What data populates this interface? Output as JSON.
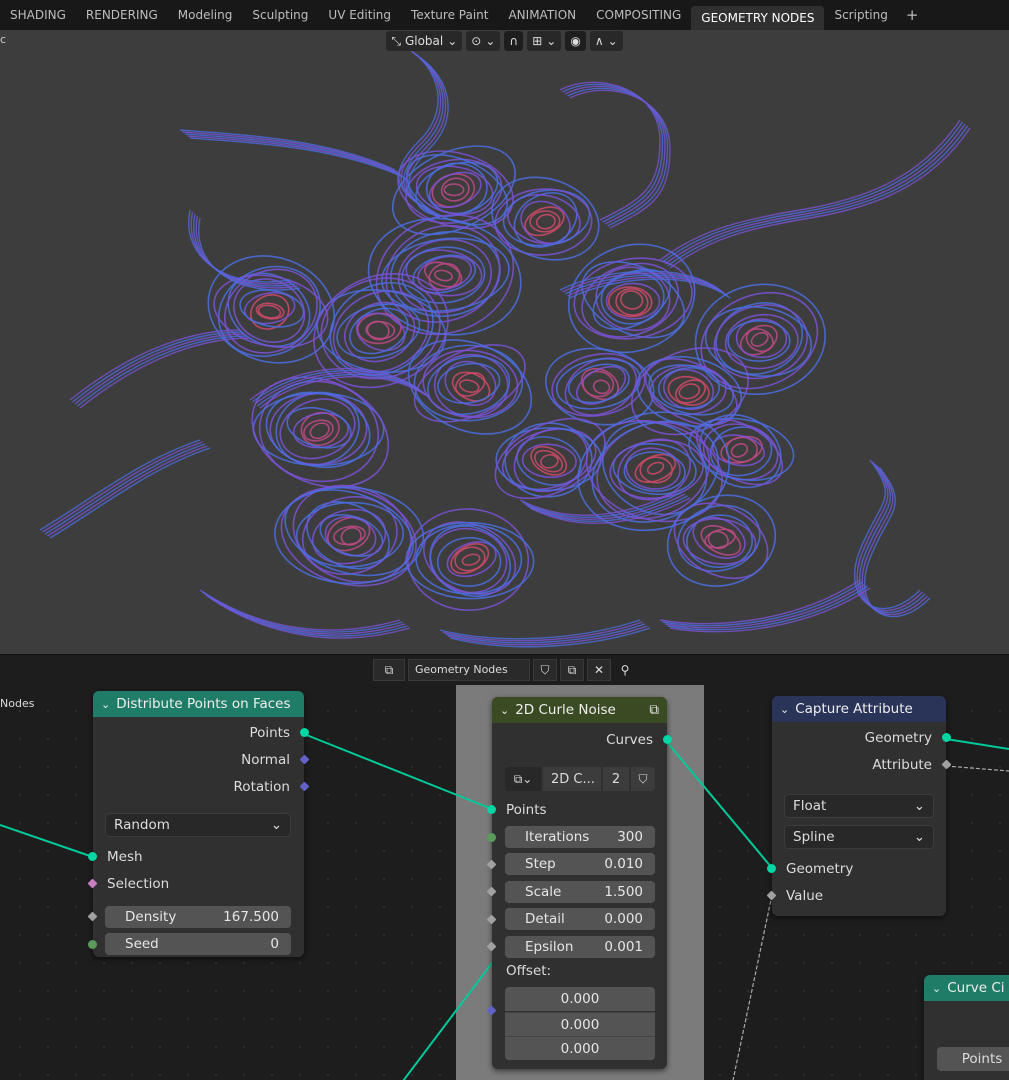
{
  "workspace_tabs": [
    {
      "label": "SHADING"
    },
    {
      "label": "RENDERING"
    },
    {
      "label": "Modeling"
    },
    {
      "label": "Sculpting"
    },
    {
      "label": "UV Editing"
    },
    {
      "label": "Texture Paint"
    },
    {
      "label": "ANIMATION"
    },
    {
      "label": "COMPOSITING"
    },
    {
      "label": "GEOMETRY NODES",
      "active": true
    },
    {
      "label": "Scripting"
    }
  ],
  "tab_add_symbol": "+",
  "viewport": {
    "left_fragment": "c",
    "transform_orientation": "Global",
    "background_color": "#3d3d3d",
    "curve_colors": [
      "#4a6ee0",
      "#7a52d6",
      "#c04a86",
      "#d04a6a"
    ]
  },
  "node_editor": {
    "tree_name": "Geometry Nodes",
    "left_label": "Nodes",
    "frame_color": "#7b7b7b"
  },
  "nodes": {
    "distribute": {
      "title": "Distribute Points on Faces",
      "outputs": [
        "Points",
        "Normal",
        "Rotation"
      ],
      "mode": "Random",
      "inputs": {
        "mesh": "Mesh",
        "selection": "Selection"
      },
      "density_label": "Density",
      "density_value": "167.500",
      "seed_label": "Seed",
      "seed_value": "0"
    },
    "curl_noise": {
      "title": "2D Curle Noise",
      "output": "Curves",
      "group_name": "2D C...",
      "user_count": "2",
      "points_label": "Points",
      "params": [
        {
          "label": "Iterations",
          "value": "300"
        },
        {
          "label": "Step",
          "value": "0.010"
        },
        {
          "label": "Scale",
          "value": "1.500"
        },
        {
          "label": "Detail",
          "value": "0.000"
        },
        {
          "label": "Epsilon",
          "value": "0.001"
        }
      ],
      "offset_label": "Offset:",
      "offset": [
        "0.000",
        "0.000",
        "0.000"
      ]
    },
    "capture": {
      "title": "Capture Attribute",
      "outputs": [
        "Geometry",
        "Attribute"
      ],
      "data_type": "Float",
      "domain": "Spline",
      "inputs": [
        "Geometry",
        "Value"
      ]
    },
    "curve_circle": {
      "title": "Curve Ci",
      "mode_button": "Points"
    }
  },
  "colors": {
    "geometry_socket": "#00d6a3",
    "vector_socket": "#6363c7",
    "boolean_socket": "#c97fc1",
    "float_socket": "#a1a1a1",
    "int_socket": "#5b9a5b",
    "geometry_header": "#1f7d67",
    "group_header": "#3a4a23",
    "attribute_header": "#2a3458"
  }
}
